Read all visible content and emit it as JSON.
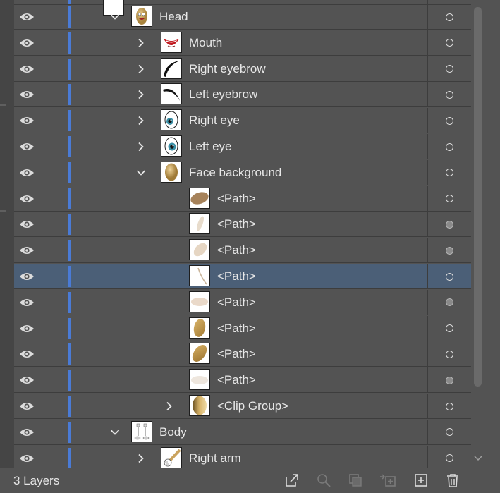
{
  "layers_panel": {
    "rows": [
      {
        "label": "Head",
        "depth": 0,
        "expander": "chevron-down-icon",
        "thumb": "potato-head-thumbnail",
        "target": "empty",
        "selected": false
      },
      {
        "label": "Mouth",
        "depth": 1,
        "expander": "chevron-right-icon",
        "thumb": "mouth-thumbnail",
        "target": "empty",
        "selected": false
      },
      {
        "label": "Right eyebrow",
        "depth": 1,
        "expander": "chevron-right-icon",
        "thumb": "right-eyebrow-thumbnail",
        "target": "empty",
        "selected": false
      },
      {
        "label": "Left eyebrow",
        "depth": 1,
        "expander": "chevron-right-icon",
        "thumb": "left-eyebrow-thumbnail",
        "target": "empty",
        "selected": false
      },
      {
        "label": "Right eye",
        "depth": 1,
        "expander": "chevron-right-icon",
        "thumb": "right-eye-thumbnail",
        "target": "empty",
        "selected": false
      },
      {
        "label": "Left eye",
        "depth": 1,
        "expander": "chevron-right-icon",
        "thumb": "left-eye-thumbnail",
        "target": "empty",
        "selected": false
      },
      {
        "label": "Face background",
        "depth": 1,
        "expander": "chevron-down-icon",
        "thumb": "face-background-thumbnail",
        "target": "empty",
        "selected": false
      },
      {
        "label": "<Path>",
        "depth": 2,
        "expander": "",
        "thumb": "path-dark-ellipse-thumbnail",
        "target": "empty",
        "selected": false
      },
      {
        "label": "<Path>",
        "depth": 2,
        "expander": "",
        "thumb": "path-light-sliver-thumbnail",
        "target": "filled",
        "selected": false
      },
      {
        "label": "<Path>",
        "depth": 2,
        "expander": "",
        "thumb": "path-light-blob-thumbnail",
        "target": "filled",
        "selected": false
      },
      {
        "label": "<Path>",
        "depth": 2,
        "expander": "",
        "thumb": "path-thin-curve-thumbnail",
        "target": "empty",
        "selected": true
      },
      {
        "label": "<Path>",
        "depth": 2,
        "expander": "",
        "thumb": "path-light-ellipse-thumbnail",
        "target": "filled",
        "selected": false
      },
      {
        "label": "<Path>",
        "depth": 2,
        "expander": "",
        "thumb": "path-gold-oval-thumbnail",
        "target": "empty",
        "selected": false
      },
      {
        "label": "<Path>",
        "depth": 2,
        "expander": "",
        "thumb": "path-gold-tilted-oval-thumbnail",
        "target": "empty",
        "selected": false
      },
      {
        "label": "<Path>",
        "depth": 2,
        "expander": "",
        "thumb": "path-faint-ellipse-thumbnail",
        "target": "filled",
        "selected": false
      },
      {
        "label": "<Clip Group>",
        "depth": 2,
        "expander": "chevron-right-icon",
        "thumb": "clip-group-thumbnail",
        "target": "empty",
        "selected": false
      },
      {
        "label": "Body",
        "depth": 0,
        "expander": "chevron-down-icon",
        "thumb": "body-thumbnail",
        "target": "empty",
        "selected": false
      },
      {
        "label": "Right arm",
        "depth": 1,
        "expander": "chevron-right-icon",
        "thumb": "right-arm-thumbnail",
        "target": "empty",
        "selected": false
      }
    ]
  },
  "footer": {
    "layer_count": "3 Layers",
    "buttons": [
      "export-icon",
      "locate-object-icon",
      "make-clipping-mask-icon",
      "create-sublayer-icon",
      "create-new-layer-icon",
      "delete-layer-icon"
    ]
  },
  "colors": {
    "panel_bg": "#535353",
    "row_selected": "#4b5f77",
    "layer_color_bar": "#4a7bd6",
    "divider": "#3d3d3d"
  }
}
